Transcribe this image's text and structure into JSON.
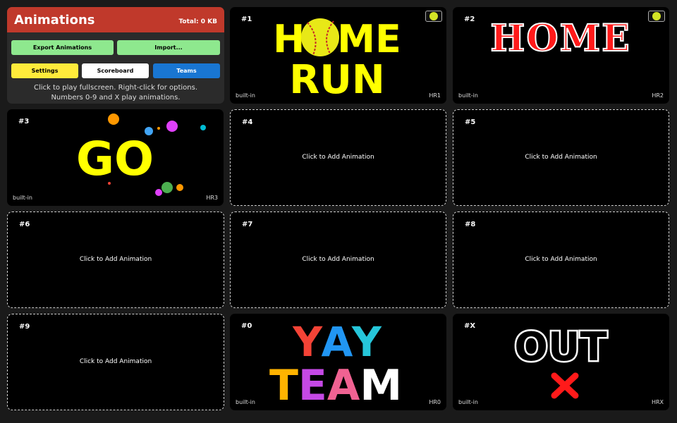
{
  "panel": {
    "title": "Animations",
    "total": "Total: 0 KB",
    "buttons": {
      "export": "Export Animations",
      "import": "Import...",
      "settings": "Settings",
      "scoreboard": "Scoreboard",
      "teams": "Teams"
    },
    "help_line1": "Click to play fullscreen. Right-click for options.",
    "help_line2": "Numbers 0-9 and X play animations."
  },
  "colors": {
    "header": "#c0392b",
    "export_btn": "#8ee88e",
    "settings_btn": "#ffeb3b",
    "teams_btn": "#1976d2"
  },
  "empty_label": "Click to Add Animation",
  "tiles": {
    "t1": {
      "num": "#1",
      "source": "built-in",
      "code": "HR1",
      "line1": "HOME",
      "line2": "RUN"
    },
    "t2": {
      "num": "#2",
      "source": "built-in",
      "code": "HR2",
      "line1": "HOME"
    },
    "t3": {
      "num": "#3",
      "source": "built-in",
      "code": "HR3",
      "line1": "GO"
    },
    "t4": {
      "num": "#4"
    },
    "t5": {
      "num": "#5"
    },
    "t6": {
      "num": "#6"
    },
    "t7": {
      "num": "#7"
    },
    "t8": {
      "num": "#8"
    },
    "t9": {
      "num": "#9"
    },
    "t0": {
      "num": "#0",
      "source": "built-in",
      "code": "HR0",
      "line1": "YAY",
      "line2": "TEAM"
    },
    "tX": {
      "num": "#X",
      "source": "built-in",
      "code": "HRX",
      "line1": "OUT"
    }
  }
}
